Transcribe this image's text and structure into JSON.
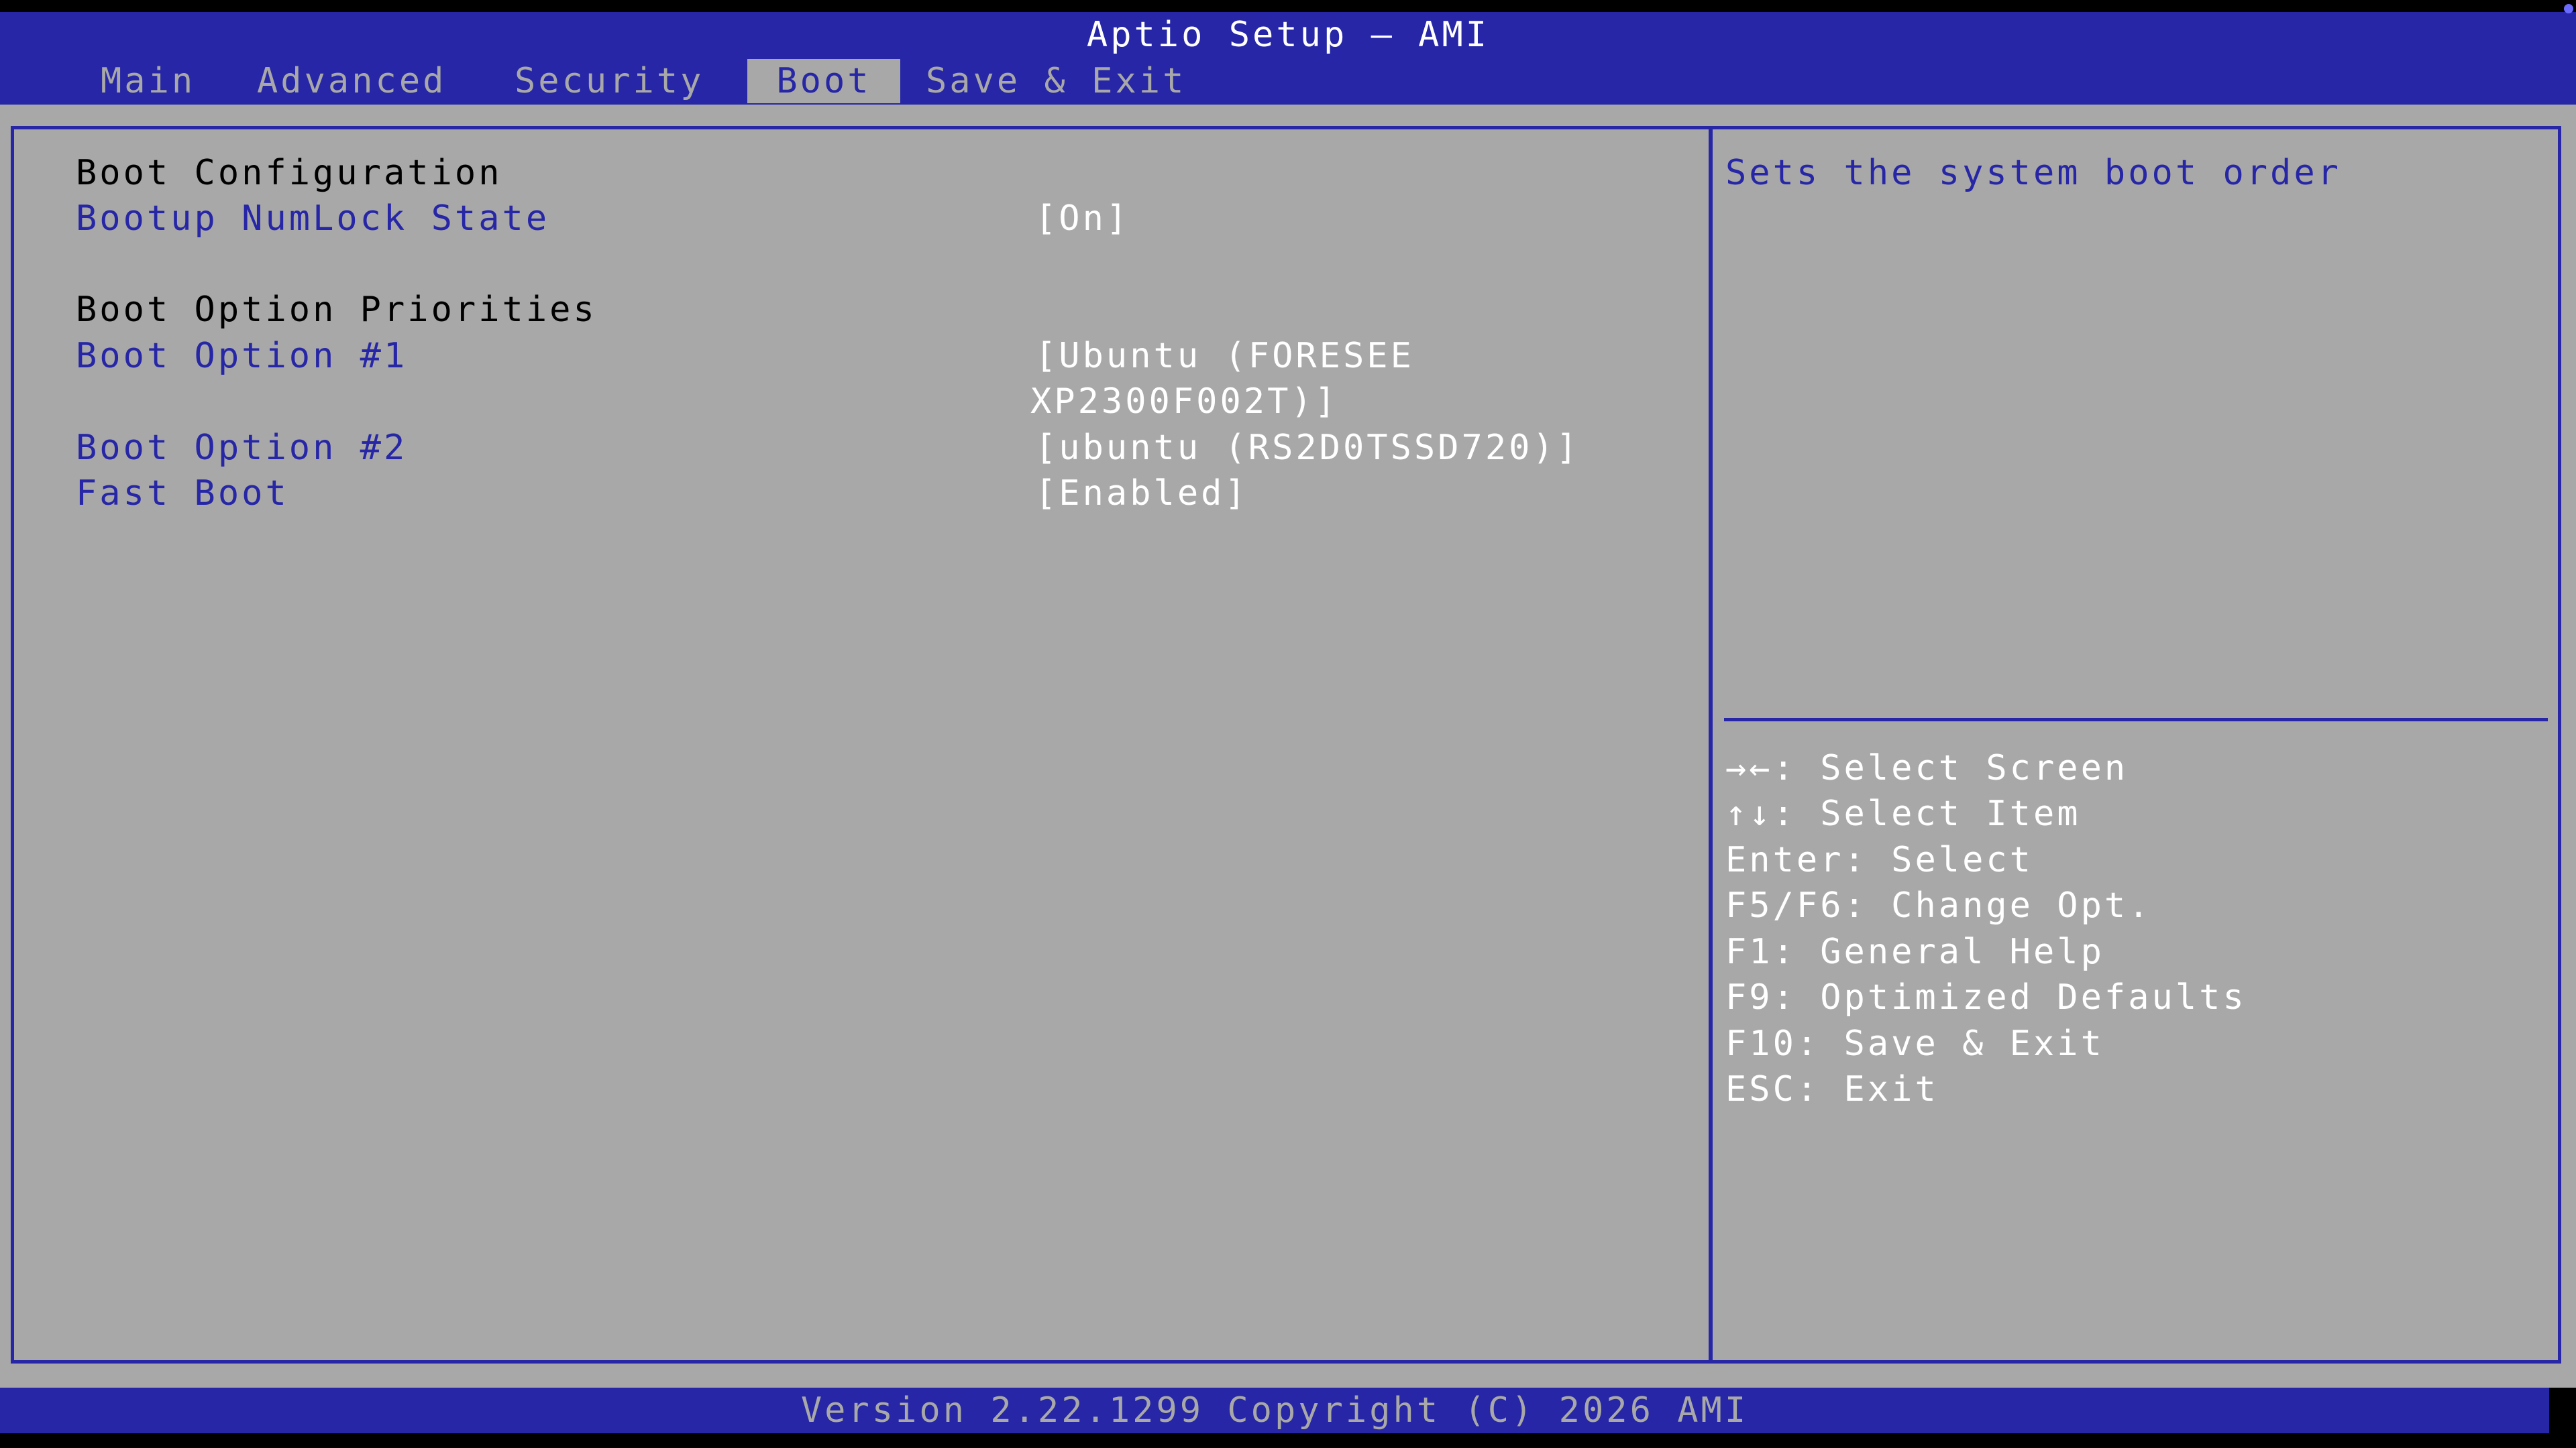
{
  "window": {
    "title": "Aptio Setup – AMI"
  },
  "tabs": [
    {
      "label": "Main",
      "active": false
    },
    {
      "label": "Advanced",
      "active": false
    },
    {
      "label": "Security",
      "active": false
    },
    {
      "label": "Boot",
      "active": true
    },
    {
      "label": "Save & Exit",
      "active": false
    }
  ],
  "sections": {
    "boot_config_header": "Boot Configuration",
    "boot_priorities_header": "Boot Option Priorities"
  },
  "settings": {
    "numlock": {
      "label": "Bootup NumLock State",
      "value": "[On]"
    },
    "boot1": {
      "label": "Boot Option #1",
      "value_line1": "[Ubuntu (FORESEE",
      "value_line2": "XP2300F002T)]"
    },
    "boot2": {
      "label": "Boot Option #2",
      "value": "[ubuntu (RS2D0TSSD720)]"
    },
    "fastboot": {
      "label": "Fast Boot",
      "value": "[Enabled]"
    }
  },
  "help": {
    "text": "Sets the system boot order"
  },
  "keys": [
    "→←: Select Screen",
    "↑↓: Select Item",
    "Enter: Select",
    "F5/F6: Change Opt.",
    "F1: General Help",
    "F9: Optimized Defaults",
    "F10: Save & Exit",
    "ESC: Exit"
  ],
  "footer": {
    "text": "Version 2.22.1299 Copyright (C) 2026 AMI"
  },
  "colors": {
    "bar_blue": "#2626a6",
    "panel_gray": "#a8a8a8",
    "white": "#ffffff",
    "black": "#000000"
  }
}
